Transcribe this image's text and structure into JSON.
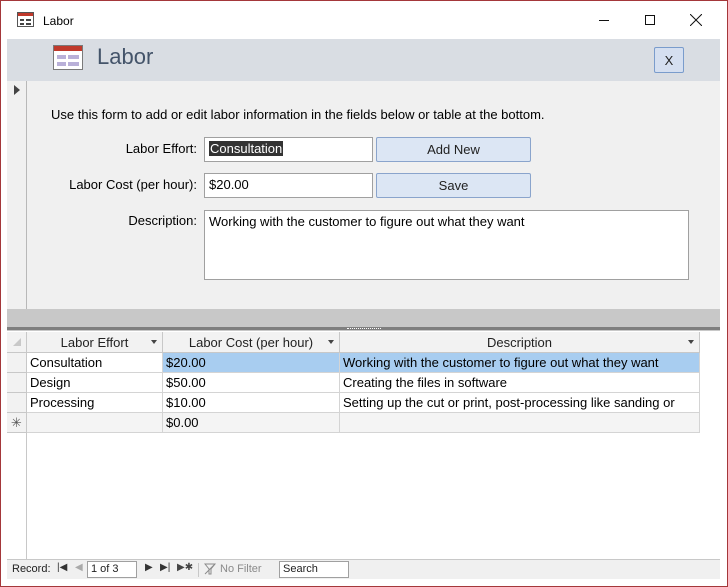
{
  "window": {
    "title": "Labor"
  },
  "header": {
    "title": "Labor",
    "close_label": "X"
  },
  "form": {
    "instructions": "Use this form to add or edit labor information in the fields below or table at the bottom.",
    "labor_effort_label": "Labor Effort:",
    "labor_effort_value": "Consultation",
    "labor_cost_label": "Labor Cost (per hour):",
    "labor_cost_value": "$20.00",
    "description_label": "Description:",
    "description_value": "Working with the customer to figure out what they want",
    "add_new_label": "Add New",
    "save_label": "Save"
  },
  "table": {
    "columns": [
      "Labor Effort",
      "Labor Cost (per hour)",
      "Description"
    ],
    "rows": [
      {
        "effort": "Consultation",
        "cost": "$20.00",
        "description": "Working with the customer to figure out what they want"
      },
      {
        "effort": "Design",
        "cost": "$50.00",
        "description": "Creating the files in software"
      },
      {
        "effort": "Processing",
        "cost": "$10.00",
        "description": "Setting up the cut or print, post-processing like sanding or"
      }
    ],
    "new_row": {
      "marker": "✳",
      "cost": "$0.00"
    }
  },
  "navigation": {
    "record_label": "Record:",
    "position": "1 of 3",
    "filter_label": "No Filter",
    "search_label": "Search"
  },
  "colors": {
    "accent": "#44546a",
    "selected_row": "#a8cdf0",
    "window_border": "#a4373a"
  }
}
